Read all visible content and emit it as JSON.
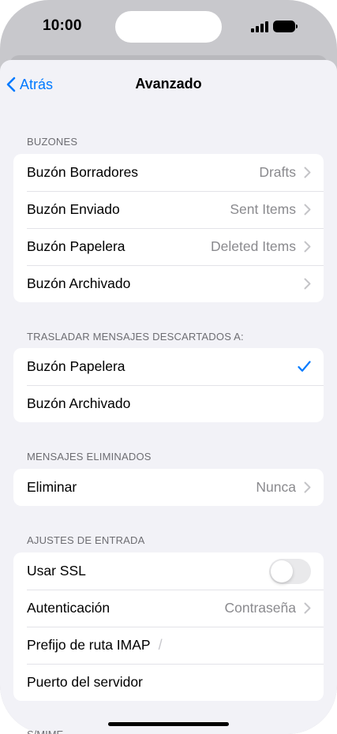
{
  "status_bar": {
    "time": "10:00"
  },
  "nav": {
    "back_label": "Atrás",
    "title": "Avanzado"
  },
  "sections": {
    "mailboxes": {
      "header": "BUZONES",
      "rows": [
        {
          "label": "Buzón Borradores",
          "value": "Drafts"
        },
        {
          "label": "Buzón Enviado",
          "value": "Sent Items"
        },
        {
          "label": "Buzón Papelera",
          "value": "Deleted Items"
        },
        {
          "label": "Buzón Archivado",
          "value": ""
        }
      ]
    },
    "move_discarded": {
      "header": "TRASLADAR MENSAJES DESCARTADOS A:",
      "rows": [
        {
          "label": "Buzón Papelera",
          "selected": true
        },
        {
          "label": "Buzón Archivado",
          "selected": false
        }
      ]
    },
    "deleted_messages": {
      "header": "MENSAJES ELIMINADOS",
      "rows": [
        {
          "label": "Eliminar",
          "value": "Nunca"
        }
      ]
    },
    "incoming_settings": {
      "header": "AJUSTES DE ENTRADA",
      "rows": [
        {
          "label": "Usar SSL",
          "toggle": false
        },
        {
          "label": "Autenticación",
          "value": "Contraseña"
        },
        {
          "label": "Prefijo de ruta IMAP",
          "value": "/"
        },
        {
          "label": "Puerto del servidor",
          "value": ""
        }
      ]
    },
    "next_header_peek": "S/MIME"
  },
  "colors": {
    "accent": "#007aff",
    "background": "#f2f2f7",
    "secondary_text": "#8a8a8e"
  }
}
